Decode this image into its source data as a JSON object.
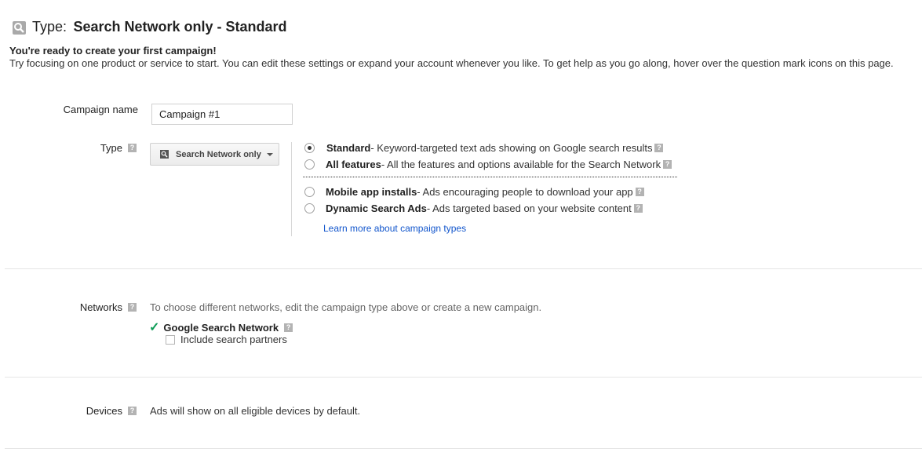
{
  "header": {
    "icon": "search-icon",
    "type_label": "Type:",
    "type_value": "Search Network only - Standard"
  },
  "intro": {
    "heading": "You're ready to create your first campaign!",
    "text": "Try focusing on one product or service to start. You can edit these settings or expand your account whenever you like. To get help as you go along, hover over the question mark icons on this page."
  },
  "campaign_name": {
    "label": "Campaign name",
    "value": "Campaign #1"
  },
  "type": {
    "label": "Type",
    "dropdown_value": "Search Network only",
    "options": [
      {
        "name": "Standard",
        "desc": " - Keyword-targeted text ads showing on Google search results",
        "selected": true
      },
      {
        "name": "All features",
        "desc": " - All the features and options available for the Search Network",
        "selected": false
      },
      {
        "name": "Mobile app installs",
        "desc": " - Ads encouraging people to download your app",
        "selected": false
      },
      {
        "name": "Dynamic Search Ads",
        "desc": " - Ads targeted based on your website content",
        "selected": false
      }
    ],
    "learn_more": "Learn more about campaign types"
  },
  "networks": {
    "label": "Networks",
    "hint": "To choose different networks, edit the campaign type above or create a new campaign.",
    "network_name": "Google Search Network",
    "include_partners_label": "Include search partners",
    "include_partners_checked": false
  },
  "devices": {
    "label": "Devices",
    "text": "Ads will show on all eligible devices by default."
  },
  "colors": {
    "link": "#1155cc",
    "check": "#0f9d58",
    "help_icon": "#b3b3b3"
  }
}
